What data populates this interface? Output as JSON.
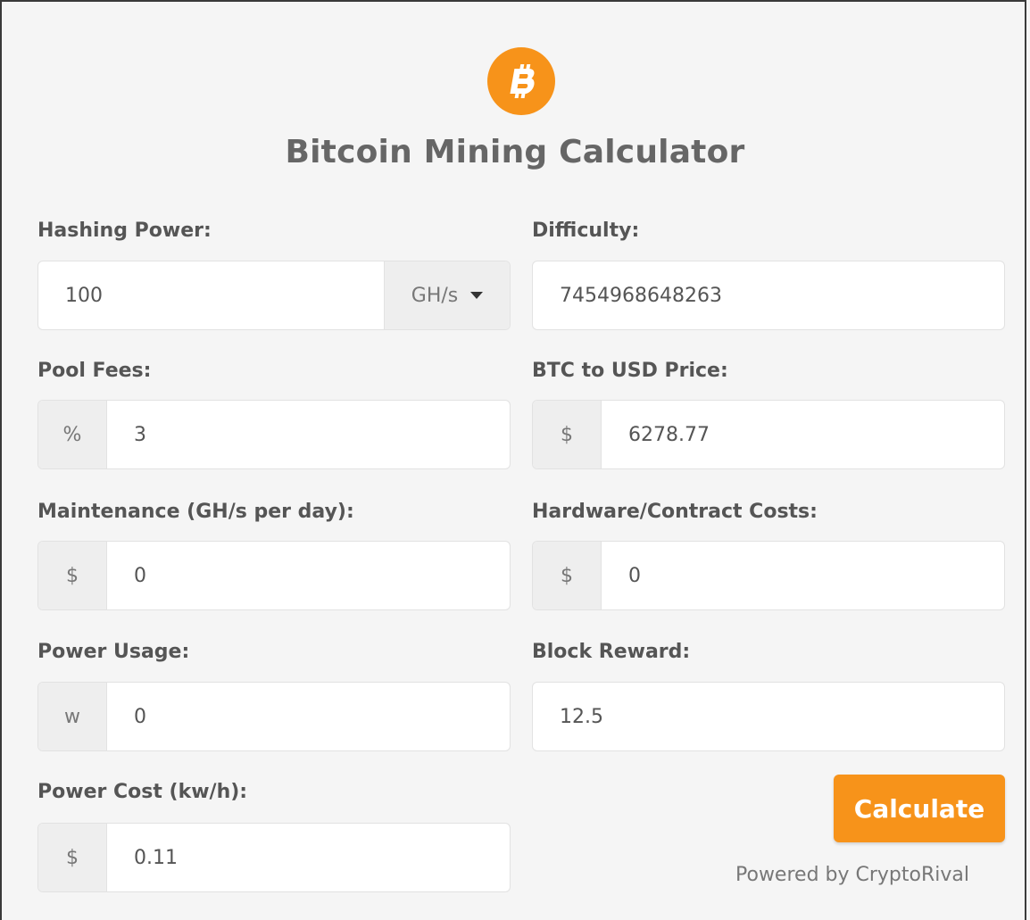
{
  "title": "Bitcoin Mining Calculator",
  "logo_icon": "bitcoin-icon",
  "brand_color": "#f7931a",
  "fields": {
    "hashing_power": {
      "label": "Hashing Power:",
      "value": "100",
      "unit": "GH/s"
    },
    "difficulty": {
      "label": "Difficulty:",
      "value": "7454968648263"
    },
    "pool_fees": {
      "label": "Pool Fees:",
      "addon": "%",
      "value": "3"
    },
    "btc_usd_price": {
      "label": "BTC to USD Price:",
      "addon": "$",
      "value": "6278.77"
    },
    "maintenance": {
      "label": "Maintenance (GH/s per day):",
      "addon": "$",
      "value": "0"
    },
    "hardware_costs": {
      "label": "Hardware/Contract Costs:",
      "addon": "$",
      "value": "0"
    },
    "power_usage": {
      "label": "Power Usage:",
      "addon": "w",
      "value": "0"
    },
    "block_reward": {
      "label": "Block Reward:",
      "value": "12.5"
    },
    "power_cost": {
      "label": "Power Cost (kw/h):",
      "addon": "$",
      "value": "0.11"
    }
  },
  "calculate_label": "Calculate",
  "powered_by": "Powered by CryptoRival"
}
